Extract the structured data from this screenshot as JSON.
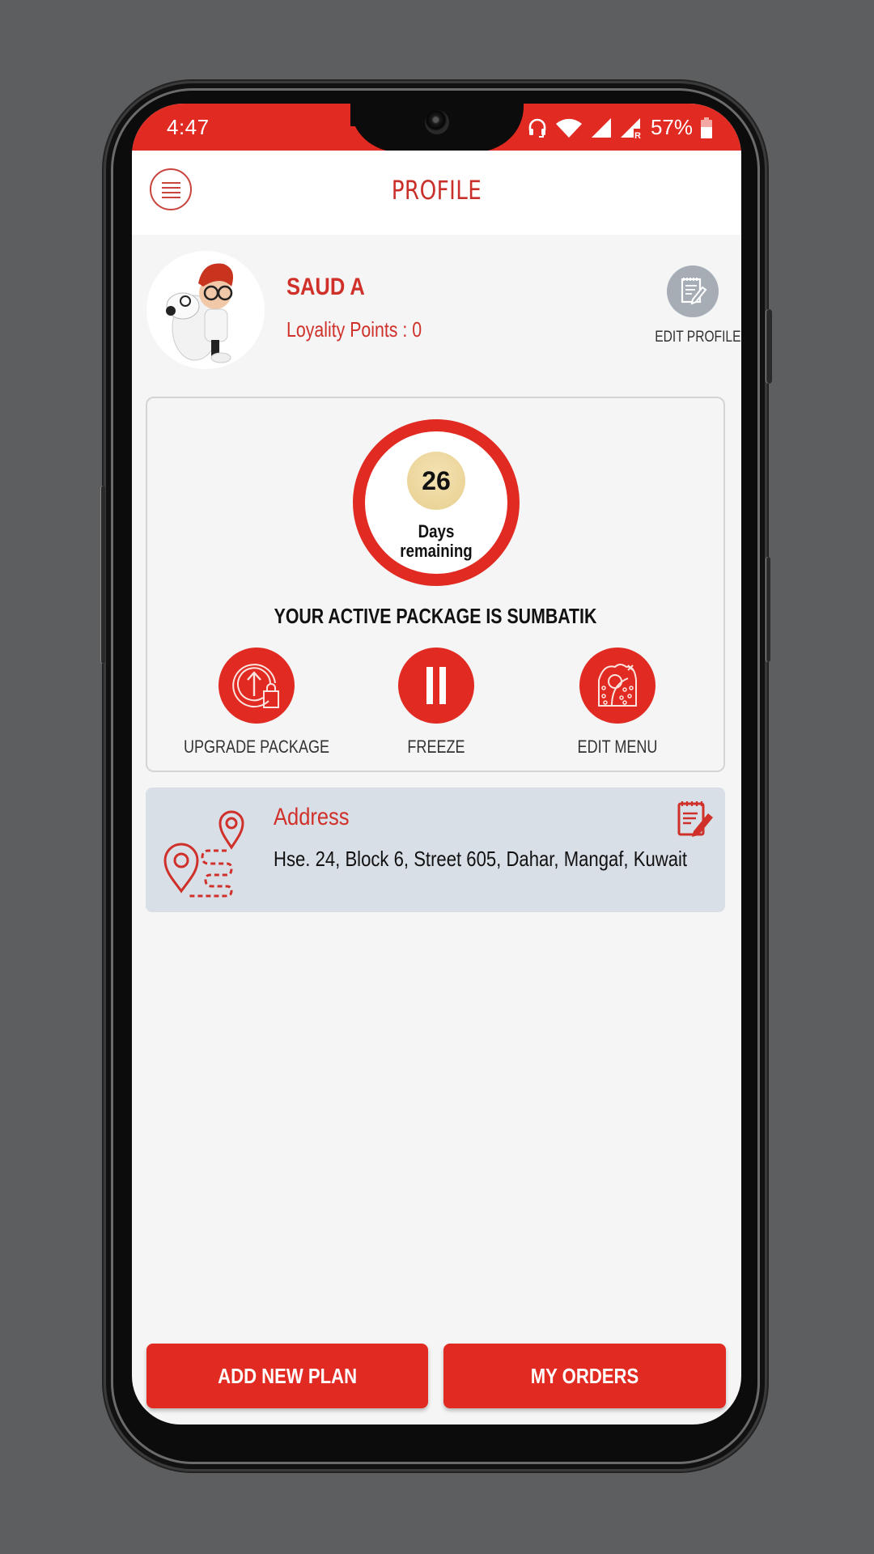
{
  "status_bar": {
    "time": "4:47",
    "battery": "57%",
    "icons": [
      "headphones-icon",
      "wifi-icon",
      "signal-icon",
      "signal-roaming-icon",
      "battery-icon"
    ]
  },
  "app_bar": {
    "title": "PROFILE",
    "menu_icon": "hamburger-menu-icon"
  },
  "profile": {
    "name": "SAUD A",
    "loyalty_points": "Loyality Points : 0",
    "edit_profile_label": "EDIT PROFILE"
  },
  "package": {
    "days_remaining": "26",
    "days_label_line1": "Days",
    "days_label_line2": "remaining",
    "active_package_text": "YOUR ACTIVE PACKAGE IS SUMBATIK",
    "actions": [
      {
        "label": "UPGRADE PACKAGE",
        "icon": "upgrade-bag-icon"
      },
      {
        "label": "FREEZE",
        "icon": "pause-icon"
      },
      {
        "label": "EDIT MENU",
        "icon": "wrap-food-icon"
      }
    ]
  },
  "address": {
    "title": "Address",
    "text": "Hse. 24, Block 6, Street 605, Dahar, Mangaf, Kuwait"
  },
  "bottom_buttons": {
    "add_new_plan": "ADD NEW PLAN",
    "my_orders": "MY ORDERS"
  },
  "colors": {
    "accent": "#e12b22",
    "title_red": "#d0302a",
    "address_bg": "#d9dfe7",
    "badge_gold": "#e8cf8e",
    "edit_profile_grey": "#a6adb5"
  }
}
